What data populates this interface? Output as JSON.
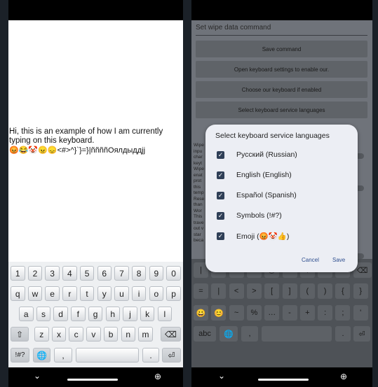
{
  "left": {
    "typed_line": "Hi, this is an example of how I am currently typing on this keyboard.",
    "typed_line2": "😡😂🤡😠😞<#>^}`}=}|ññññОялдыддјј",
    "keyboard": {
      "row_numbers": [
        "1",
        "2",
        "3",
        "4",
        "5",
        "6",
        "7",
        "8",
        "9",
        "0"
      ],
      "row_q": [
        "q",
        "w",
        "e",
        "r",
        "t",
        "y",
        "u",
        "i",
        "o",
        "p"
      ],
      "row_a": [
        "a",
        "s",
        "d",
        "f",
        "g",
        "h",
        "j",
        "k",
        "l"
      ],
      "shift": "⇧",
      "row_z": [
        "z",
        "x",
        "c",
        "v",
        "b",
        "n",
        "m"
      ],
      "backspace": "⌫",
      "symbols": "!#?",
      "globe": "🌐",
      "comma": ",",
      "period": ".",
      "enter": "⏎"
    },
    "nav": {
      "back": "⌄",
      "globe": "⊕"
    }
  },
  "right": {
    "command_placeholder": "Set wipe data command",
    "buttons": [
      "Save command",
      "Open keyboard settings to enable our.",
      "Choose our keyboard if enabled",
      "Select keyboard service languages"
    ],
    "side_fragments": [
      "Wipe",
      "inpu",
      "char",
      "keyt",
      "Wipe",
      "enat",
      "prot",
      "this",
      "temp",
      "Rese",
      "than",
      "Wor",
      "This",
      "trave",
      "out v",
      "star",
      "beca"
    ],
    "dialog": {
      "title": "Select keyboard service languages",
      "options": [
        "Русский (Russian)",
        "English (English)",
        "Español (Spanish)",
        "Symbols (!#?)",
        "Emoji (😡🤡👍)"
      ],
      "check": "✓",
      "cancel": "Cancel",
      "save": "Save"
    },
    "keyboard": {
      "row1": [
        "|",
        "\\",
        "`",
        "*",
        "@",
        "#",
        "$",
        "^",
        "&"
      ],
      "row2": [
        "=",
        "|",
        "<",
        ">",
        "[",
        "]",
        "(",
        ")",
        "{",
        "}"
      ],
      "row3": [
        "😀",
        "😊",
        "~",
        "%",
        "…",
        "-",
        "+",
        ":",
        ";",
        "'"
      ],
      "abc": "abc",
      "globe": "🌐",
      "comma": ",",
      "period": ".",
      "enter": "⏎"
    },
    "nav": {
      "back": "⌄",
      "globe": "⊕"
    }
  }
}
